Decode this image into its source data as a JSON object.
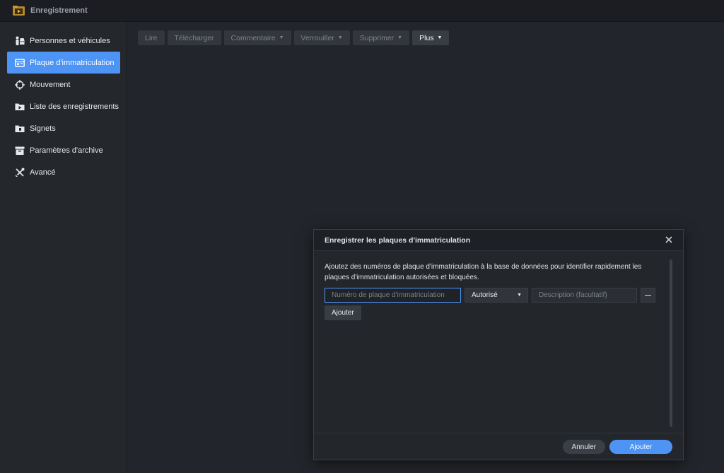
{
  "app": {
    "title": "Enregistrement",
    "icon": "film-folder-icon"
  },
  "sidebar": {
    "items": [
      {
        "label": "Personnes et véhicules",
        "icon": "person-car-icon",
        "active": false
      },
      {
        "label": "Plaque d'immatriculation",
        "icon": "license-plate-icon",
        "active": true
      },
      {
        "label": "Mouvement",
        "icon": "crosshair-icon",
        "active": false
      },
      {
        "label": "Liste des enregistrements",
        "icon": "folder-video-icon",
        "active": false
      },
      {
        "label": "Signets",
        "icon": "bookmark-folder-icon",
        "active": false
      },
      {
        "label": "Paramètres d'archive",
        "icon": "archive-box-icon",
        "active": false
      },
      {
        "label": "Avancé",
        "icon": "tools-icon",
        "active": false
      }
    ]
  },
  "toolbar": {
    "lire": "Lire",
    "telecharger": "Télécharger",
    "commentaire": "Commentaire",
    "verrouiller": "Verrouiller",
    "supprimer": "Supprimer",
    "plus": "Plus"
  },
  "dialog": {
    "title": "Enregistrer les plaques d'immatriculation",
    "description": "Ajoutez des numéros de plaque d'immatriculation à la base de données pour identifier rapidement les plaques d'immatriculation autorisées et bloquées.",
    "plate_placeholder": "Numéro de plaque d'immatriculation",
    "status_selected": "Autorisé",
    "description_placeholder": "Description (facultatif)",
    "add_row_label": "Ajouter",
    "cancel_label": "Annuler",
    "confirm_label": "Ajouter"
  },
  "colors": {
    "accent": "#4d94f5",
    "background": "#22252b",
    "sidebar": "#24272c"
  }
}
